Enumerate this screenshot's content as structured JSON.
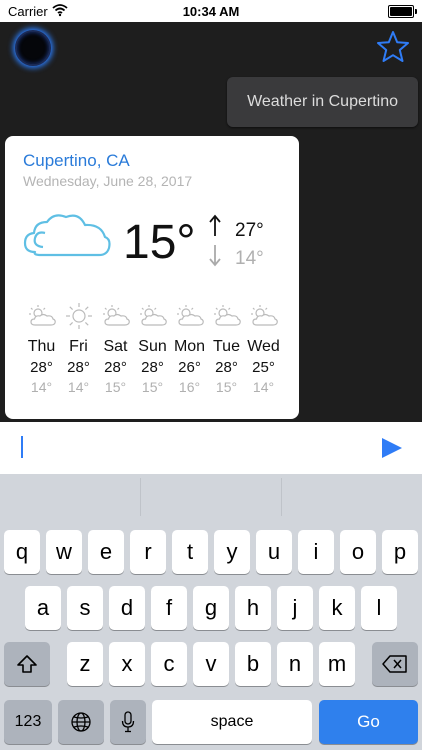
{
  "status_bar": {
    "carrier": "Carrier",
    "time": "10:34 AM"
  },
  "chat": {
    "user_message": "Weather in Cupertino",
    "weather": {
      "city": "Cupertino, CA",
      "date": "Wednesday, June 28, 2017",
      "current_temp": "15°",
      "high": "27°",
      "low": "14°",
      "forecast": [
        {
          "day": "Thu",
          "high": "28°",
          "low": "14°",
          "icon": "partly-cloudy-icon"
        },
        {
          "day": "Fri",
          "high": "28°",
          "low": "14°",
          "icon": "sunny-icon"
        },
        {
          "day": "Sat",
          "high": "28°",
          "low": "15°",
          "icon": "partly-cloudy-icon"
        },
        {
          "day": "Sun",
          "high": "28°",
          "low": "15°",
          "icon": "partly-cloudy-icon"
        },
        {
          "day": "Mon",
          "high": "26°",
          "low": "16°",
          "icon": "partly-cloudy-icon"
        },
        {
          "day": "Tue",
          "high": "28°",
          "low": "15°",
          "icon": "partly-cloudy-icon"
        },
        {
          "day": "Wed",
          "high": "25°",
          "low": "14°",
          "icon": "partly-cloudy-icon"
        }
      ]
    }
  },
  "input": {
    "value": "",
    "placeholder": ""
  },
  "keyboard": {
    "row1": [
      "q",
      "w",
      "e",
      "r",
      "t",
      "y",
      "u",
      "i",
      "o",
      "p"
    ],
    "row2": [
      "a",
      "s",
      "d",
      "f",
      "g",
      "h",
      "j",
      "k",
      "l"
    ],
    "row3": [
      "z",
      "x",
      "c",
      "v",
      "b",
      "n",
      "m"
    ],
    "numbers_label": "123",
    "space_label": "space",
    "go_label": "Go"
  },
  "colors": {
    "accent": "#2f7cf6",
    "city": "#2a7bd9",
    "go_key": "#2f80ed",
    "orb_glow": "#2b7fff"
  }
}
